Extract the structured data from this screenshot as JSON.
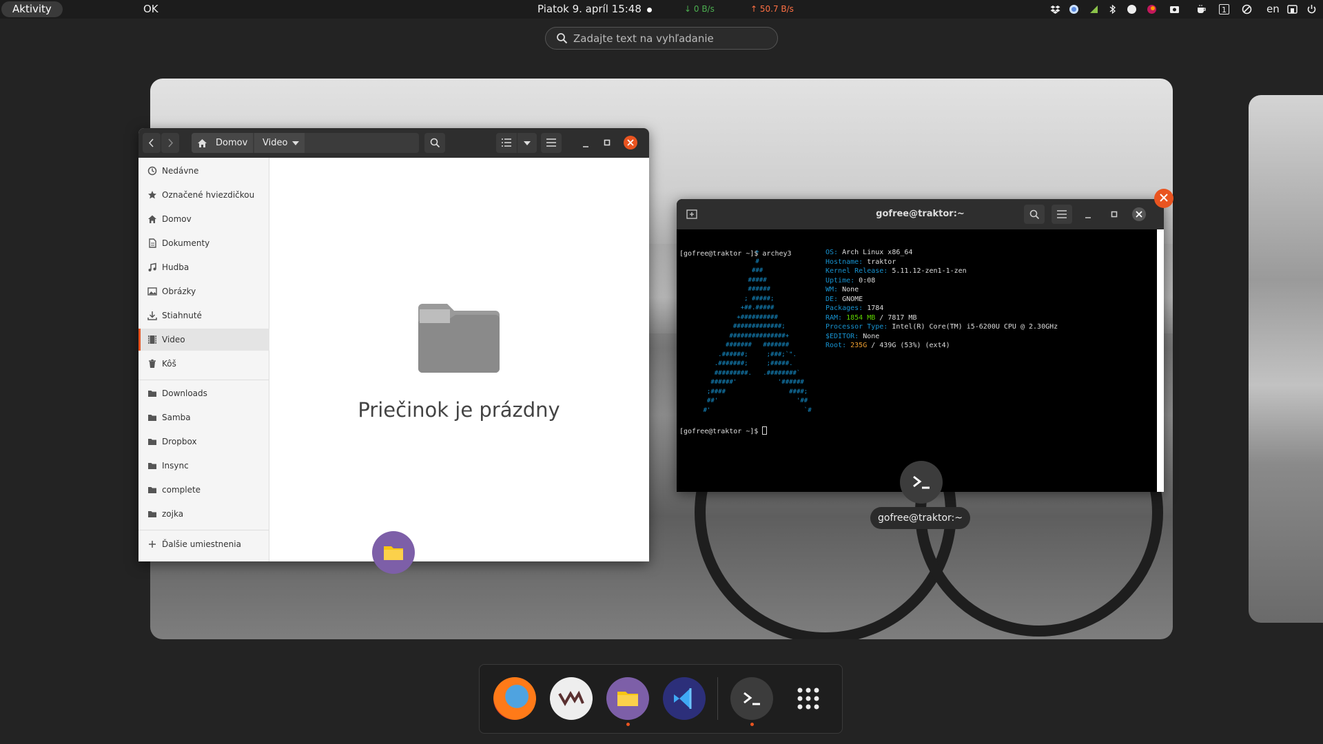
{
  "topbar": {
    "activities": "Aktivity",
    "ok": "OK",
    "clock": "Piatok  9. apríl  15:48",
    "net_down": "↓ 0 B/s",
    "net_up": "↑ 50.7 B/s",
    "lang": "en",
    "tray_icons": [
      "dropbox-icon",
      "chat-icon",
      "extension-icon",
      "bluetooth-icon",
      "notification-icon",
      "color-icon",
      "screenshot-icon",
      "coffee-icon",
      "workspace-indicator-icon",
      "disable-icon",
      "network-icon",
      "power-icon"
    ],
    "workspace_number": "1"
  },
  "search": {
    "placeholder": "Zadajte text na vyhľadanie"
  },
  "files": {
    "crumbs": {
      "home": "Domov",
      "video": "Video"
    },
    "sidebar": [
      {
        "label": "Nedávne",
        "icon": "clock-icon"
      },
      {
        "label": "Označené hviezdičkou",
        "icon": "star-icon"
      },
      {
        "label": "Domov",
        "icon": "home-icon"
      },
      {
        "label": "Dokumenty",
        "icon": "document-icon"
      },
      {
        "label": "Hudba",
        "icon": "music-icon"
      },
      {
        "label": "Obrázky",
        "icon": "image-icon"
      },
      {
        "label": "Stiahnuté",
        "icon": "download-icon"
      },
      {
        "label": "Video",
        "icon": "video-icon",
        "active": true
      },
      {
        "label": "Kôš",
        "icon": "trash-icon"
      },
      {
        "label": "Downloads",
        "icon": "folder-icon"
      },
      {
        "label": "Samba",
        "icon": "folder-icon"
      },
      {
        "label": "Dropbox",
        "icon": "folder-icon"
      },
      {
        "label": "Insync",
        "icon": "folder-icon"
      },
      {
        "label": "complete",
        "icon": "folder-icon"
      },
      {
        "label": "zojka",
        "icon": "folder-icon"
      }
    ],
    "other_locations": "Ďalšie umiestnenia",
    "empty": "Priečinok je prázdny"
  },
  "terminal": {
    "title": "gofree@traktor:~",
    "tooltip": "gofree@traktor:~",
    "prompt1": "[gofree@traktor ~]$ archey3",
    "prompt2": "[gofree@traktor ~]$ ",
    "info": {
      "os_k": "OS:",
      "os_v": " Arch Linux x86_64",
      "host_k": "Hostname:",
      "host_v": " traktor",
      "kernel_k": "Kernel Release:",
      "kernel_v": " 5.11.12-zen1-1-zen",
      "uptime_k": "Uptime:",
      "uptime_v": " 0:08",
      "wm_k": "WM:",
      "wm_v": " None",
      "de_k": "DE:",
      "de_v": " GNOME",
      "pkg_k": "Packages:",
      "pkg_v": " 1784",
      "ram_k": "RAM:",
      "ram_used": " 1854 MB",
      "ram_v": " / 7817 MB",
      "cpu_k": "Processor Type:",
      "cpu_v": " Intel(R) Core(TM) i5-6200U CPU @ 2.30GHz",
      "editor_k": "$EDITOR:",
      "editor_v": " None",
      "root_k": "Root:",
      "root_used": " 235G",
      "root_v": " / 439G (53%) (ext4)"
    }
  },
  "dash": {
    "apps": [
      "firefox-icon",
      "vivaldi-icon",
      "files-icon",
      "vscode-icon",
      "terminal-icon",
      "show-apps-icon"
    ]
  }
}
